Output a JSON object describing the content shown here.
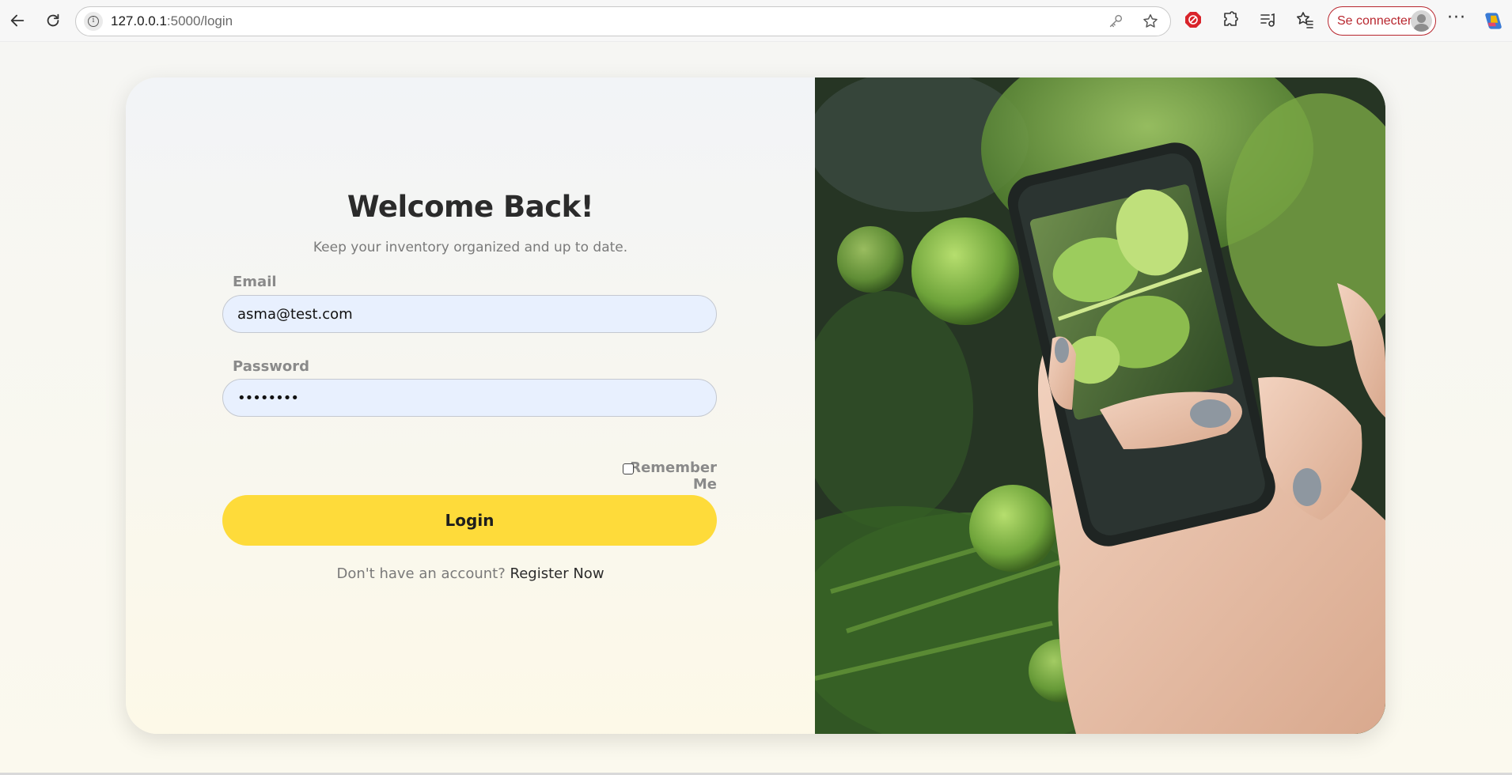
{
  "browser": {
    "url_host": "127.0.0.1",
    "url_path": ":5000/login",
    "signin_label": "Se connecter"
  },
  "colors": {
    "accent": "#fedb3a",
    "signin_border": "#b8262e",
    "input_bg": "#e8f0fe"
  },
  "login": {
    "title": "Welcome Back!",
    "subtitle": "Keep your inventory organized and up to date.",
    "email_label": "Email",
    "email_value": "asma@test.com",
    "password_label": "Password",
    "password_value": "••••••••",
    "remember_label": "Remember Me",
    "login_button": "Login",
    "no_account_text": "Don't have an account?",
    "register_link": "Register Now"
  },
  "image": {
    "icon": "phone-photo-of-vegetables-image"
  }
}
